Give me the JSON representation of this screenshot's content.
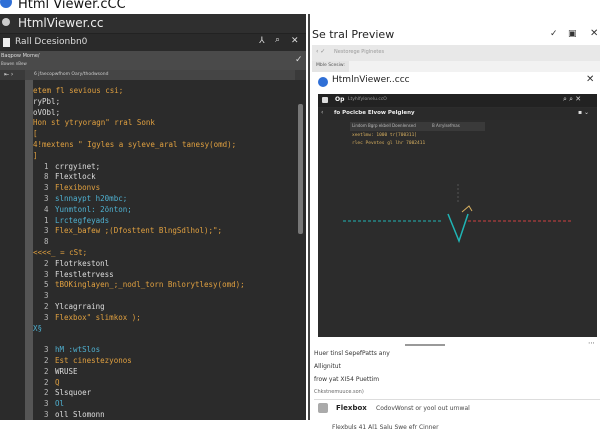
{
  "window": {
    "title": "Html Viewer.cCC"
  },
  "editor": {
    "title": "HtmlViewer.cc",
    "toolbar_label": "Rall Dcesionbn0",
    "panel_title": "Baqpow Mome/",
    "panel_subtitle": "Bowen nBew",
    "path": "6 jfaecopwfhom Oary/thodwsond",
    "code_lines": [
      {
        "num": "",
        "text": "etem  fl sevious  csi;",
        "color": "#e0a040"
      },
      {
        "num": "",
        "text": "ryPbl;",
        "color": "#dddddd"
      },
      {
        "num": "",
        "text": "oVObl;",
        "color": "#dddddd"
      },
      {
        "num": "",
        "text": "   Hon st ytryoragn\" rral Sonk",
        "color": "#e0a040"
      },
      {
        "num": "",
        "text": " [",
        "color": "#e0a040"
      },
      {
        "num": "",
        "text": "  4!mextens \"  Igyles a  syleve_aral tanesy(omd);",
        "color": "#e0a040"
      },
      {
        "num": "",
        "text": "]",
        "color": "#e0a040"
      },
      {
        "num": "1",
        "text": "crrgyinet;",
        "color": "#dddddd"
      },
      {
        "num": "8",
        "text": "Flextlock",
        "color": "#dddddd"
      },
      {
        "num": "3",
        "text": "Flexibonvs",
        "color": "#e0a040"
      },
      {
        "num": "3",
        "text": "slnnaypt h20mbc;",
        "color": "#4fb0d0"
      },
      {
        "num": "4",
        "text": "Yunmtonl: 2önton;",
        "color": "#4fb0d0"
      },
      {
        "num": "1",
        "text": "Lrctegfeyads",
        "color": "#4fb0d0"
      },
      {
        "num": "3",
        "text": "Flex_bafew ;(Dfosttent  BlngSdlhol);\";",
        "color": "#e0a040"
      },
      {
        "num": "8",
        "text": "",
        "color": "#dddddd"
      },
      {
        "num": "",
        "text": "<<<<_  = cSt;",
        "color": "#e0a040"
      },
      {
        "num": "2",
        "text": "Flotrkestonl",
        "color": "#dddddd"
      },
      {
        "num": "3",
        "text": "Flestletrvess",
        "color": "#dddddd"
      },
      {
        "num": "5",
        "text": "tBOKinglayen_;_nodl_torn Bnlorytlesy(omd);",
        "color": "#e0a040"
      },
      {
        "num": "3",
        "text": "",
        "color": "#dddddd"
      },
      {
        "num": "2",
        "text": "Ylcagrraing",
        "color": "#dddddd"
      },
      {
        "num": "3",
        "text": "Flexbox\"  slimkox );",
        "color": "#e0a040"
      },
      {
        "num": "",
        "text": " X§",
        "color": "#4fb0d0"
      },
      {
        "num": "",
        "text": "",
        "color": "#e0a040"
      },
      {
        "num": "3",
        "text": "hM  :wtSlos",
        "color": "#4fb0d0"
      },
      {
        "num": "2",
        "text": "Est cinestezyonos",
        "color": "#e0a040"
      },
      {
        "num": "2",
        "text": "WRUSE",
        "color": "#dddddd"
      },
      {
        "num": "2",
        "text": "Q",
        "color": "#e0a040"
      },
      {
        "num": "2",
        "text": " Slsquoer",
        "color": "#dddddd"
      },
      {
        "num": "3",
        "text": "Ol",
        "color": "#4fb0d0"
      },
      {
        "num": "3",
        "text": "oll  Slomonn",
        "color": "#dddddd"
      }
    ]
  },
  "preview": {
    "title": "Se tral Preview",
    "nav": "Nestorege Piglnetes",
    "tab": "Mble Scesiw:",
    "card_title": "HtmlnViewer..ccc",
    "inner_title": "Op",
    "inner_url": "Ltyhlfylonelu.ccO",
    "inner_subtitle": "fo Poclcbe  Elvow  Pelgleny",
    "inner_tab1": "Lindom  Bgrp ekbell  Doenlensed",
    "inner_tab2": "B Arrylsefmas",
    "inner_code": [
      "xeetlmw:  1000  tr[700311]",
      "rlec Pevntes gl lhr 7002411"
    ],
    "lines": [
      "Huer tinsl SepefPatts any",
      "Allignitut",
      "frow yat XI54 Puettim",
      "Chkstnemuuce.son)"
    ],
    "list_item_title": "Flexbox",
    "list_item_text": "CodovWonst or yool out urnwal",
    "list_item2": "Flexbuls  41 Al1 Salu Swe efr Cinner"
  }
}
